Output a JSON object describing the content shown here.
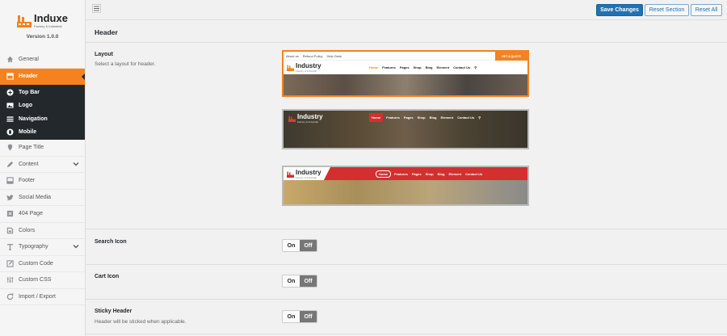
{
  "brand": {
    "name": "Induxe",
    "tagline": "Factory & Industrial",
    "version": "Version 1.0.0"
  },
  "sidebar": {
    "items": [
      {
        "label": "General"
      },
      {
        "label": "Header"
      },
      {
        "label": "Page Title"
      },
      {
        "label": "Content"
      },
      {
        "label": "Footer"
      },
      {
        "label": "Social Media"
      },
      {
        "label": "404 Page"
      },
      {
        "label": "Colors"
      },
      {
        "label": "Typography"
      },
      {
        "label": "Custom Code"
      },
      {
        "label": "Custom CSS"
      },
      {
        "label": "Import / Export"
      }
    ],
    "sub_items": [
      {
        "label": "Top Bar"
      },
      {
        "label": "Logo"
      },
      {
        "label": "Navigation"
      },
      {
        "label": "Mobile"
      }
    ]
  },
  "toolbar": {
    "save_label": "Save Changes",
    "reset_section_label": "Reset Section",
    "reset_all_label": "Reset All"
  },
  "section": {
    "title": "Header"
  },
  "layout": {
    "label": "Layout",
    "description": "Select a layout for header.",
    "preview": {
      "brand": "Industry",
      "tagline": "Factory & Industrial",
      "top_links": [
        "About us",
        "Refund Policy",
        "Help Desk"
      ],
      "quote_button": "GET A QUOTE",
      "menu": [
        "Home",
        "Features",
        "Pages",
        "Shop",
        "Blog",
        "Element",
        "Contact Us"
      ]
    }
  },
  "search_icon": {
    "label": "Search Icon",
    "on": "On",
    "off": "Off"
  },
  "cart_icon": {
    "label": "Cart Icon",
    "on": "On",
    "off": "Off"
  },
  "sticky_header": {
    "label": "Sticky Header",
    "description": "Header will be sticked when applicable.",
    "on": "On",
    "off": "Off"
  },
  "colors": {
    "accent": "#f4821f",
    "primary_button": "#2271b1",
    "dark": "#23282d",
    "preview_red": "#d32f2f"
  }
}
